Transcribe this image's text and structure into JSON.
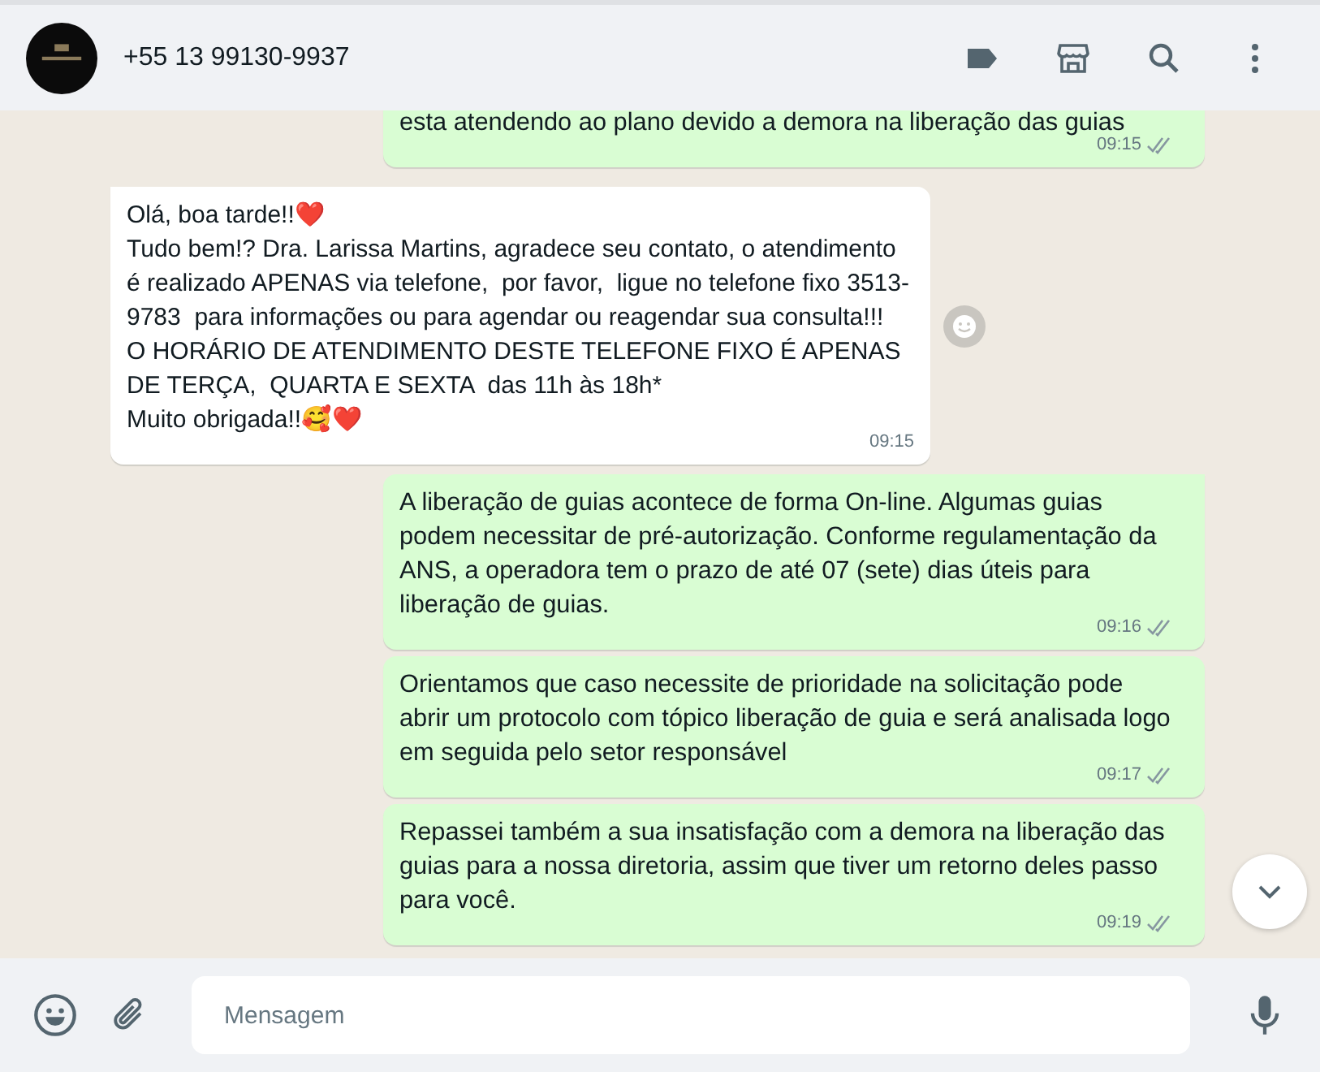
{
  "header": {
    "contact": "+55 13 99130-9937"
  },
  "messages": [
    {
      "kind": "outgoing",
      "text": "esta atendendo ao plano devido a demora na liberação das guias",
      "time": "09:15",
      "read": false
    },
    {
      "kind": "incoming",
      "text": "Olá, boa tarde!!❤️\nTudo bem!? Dra. Larissa Martins, agradece seu contato, o atendimento é realizado APENAS via telefone,  por favor,  ligue no telefone fixo 3513-9783  para informações ou para agendar ou reagendar sua consulta!!!\nO HORÁRIO DE ATENDIMENTO DESTE TELEFONE FIXO É APENAS DE TERÇA,  QUARTA E SEXTA  das 11h às 18h*\nMuito obrigada!!🥰❤️",
      "time": "09:15",
      "react": true
    },
    {
      "kind": "outgoing",
      "text": "A liberação de guias acontece de forma On-line. Algumas guias podem necessitar de pré-autorização. Conforme regulamentação da ANS, a operadora tem o prazo de até 07 (sete) dias úteis para liberação de guias.",
      "time": "09:16",
      "read": false,
      "tail": true
    },
    {
      "kind": "outgoing",
      "text": "Orientamos que caso necessite de prioridade na solicitação pode abrir um protocolo com tópico liberação de guia e será analisada logo em seguida pelo setor responsável",
      "time": "09:17",
      "read": false
    },
    {
      "kind": "outgoing",
      "text": "Repassei também a sua insatisfação com a demora na liberação das guias para a nossa diretoria, assim que tiver um retorno deles passo para você.",
      "time": "09:19",
      "read": false
    }
  ],
  "composer": {
    "placeholder": "Mensagem"
  }
}
